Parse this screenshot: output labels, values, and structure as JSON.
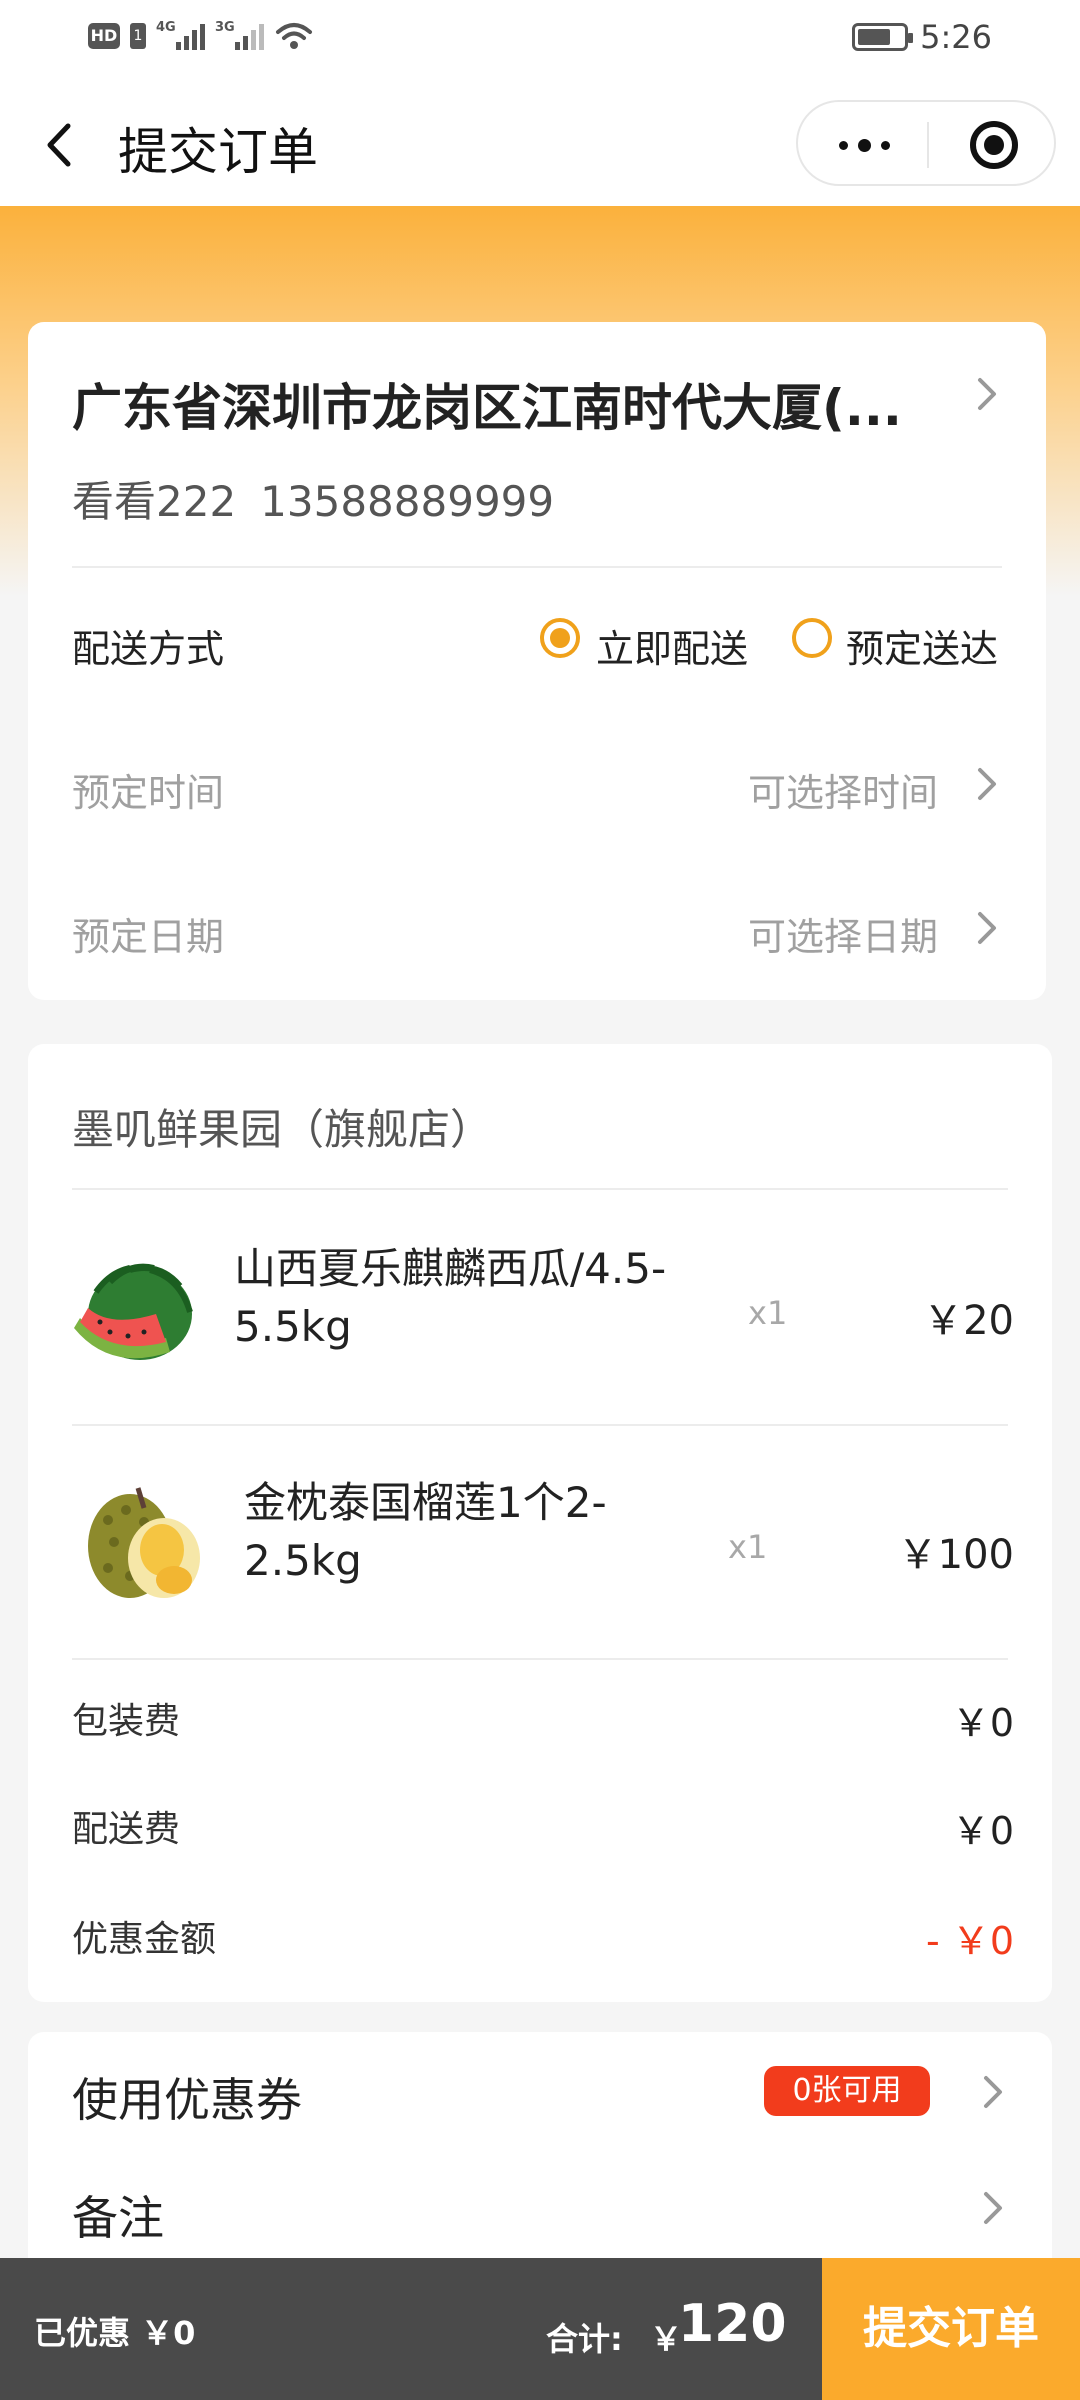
{
  "status_bar": {
    "hd": "HD",
    "sim": "1",
    "net1": "4G",
    "net2": "3G",
    "time": "5:26",
    "icons": [
      "signal-icon",
      "wifi-icon",
      "battery-icon"
    ]
  },
  "nav": {
    "title": "提交订单",
    "icons": [
      "back-icon",
      "more-icon",
      "close-icon"
    ]
  },
  "address": {
    "line": "广东省深圳市龙岗区江南时代大厦(...",
    "name": "看看222",
    "phone": "13588889999"
  },
  "delivery": {
    "label": "配送方式",
    "options": [
      {
        "label": "立即配送",
        "selected": true
      },
      {
        "label": "预定送达",
        "selected": false
      }
    ],
    "time_label": "预定时间",
    "time_value": "可选择时间",
    "date_label": "预定日期",
    "date_value": "可选择日期"
  },
  "order": {
    "store": "墨叽鲜果园（旗舰店）",
    "items": [
      {
        "name_line1": "山西夏乐麒麟西瓜/4.5-",
        "name_line2": "5.5kg",
        "qty": "x1",
        "price": "￥20",
        "image": "watermelon-image"
      },
      {
        "name_line1": "金枕泰国榴莲1个2-",
        "name_line2": "2.5kg",
        "qty": "x1",
        "price": "￥100",
        "image": "durian-image"
      }
    ],
    "fees": [
      {
        "label": "包装费",
        "value": "￥0"
      },
      {
        "label": "配送费",
        "value": "￥0"
      },
      {
        "label": "优惠金额",
        "value": "- ￥0"
      }
    ]
  },
  "extras": {
    "coupon_label": "使用优惠券",
    "coupon_badge": "0张可用",
    "note_label": "备注"
  },
  "bottom": {
    "saved": "已优惠 ￥0",
    "total_label": "合计:",
    "currency": "￥",
    "total": "120",
    "submit": "提交订单"
  },
  "colors": {
    "accent": "#fbaa2c",
    "radio": "#f0a11b",
    "discount_red": "#f23c1c",
    "bottom_bar": "#4a4a4a"
  }
}
